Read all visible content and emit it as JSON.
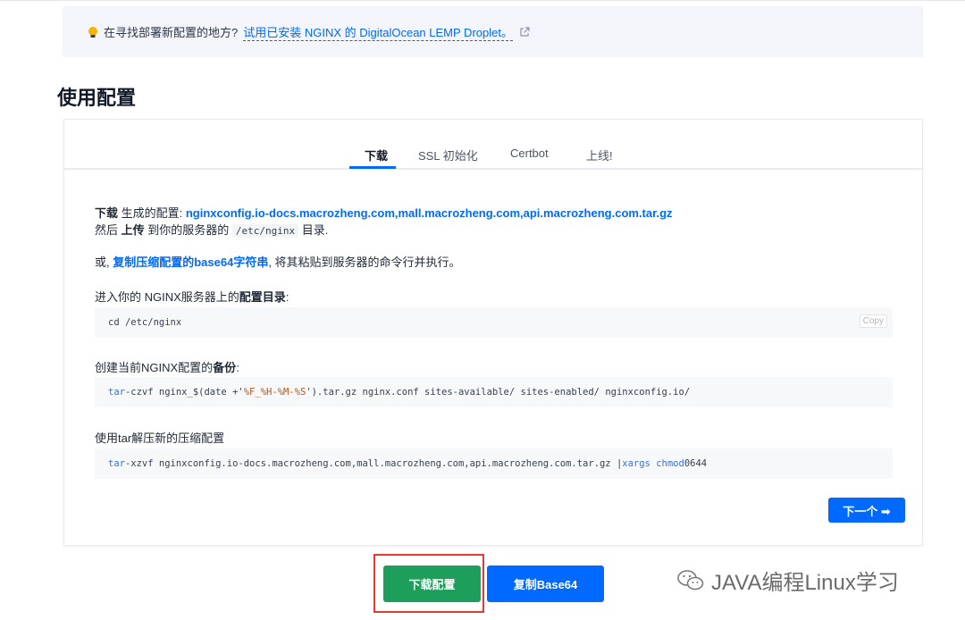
{
  "notice": {
    "question": "在寻找部署新配置的地方?",
    "link": "试用已安装 NGINX 的 DigitalOcean LEMP Droplet。",
    "icons": [
      "lightbulb-icon",
      "external-link-icon"
    ]
  },
  "section_title": "使用配置",
  "tabs": [
    {
      "label": "下载",
      "active": true
    },
    {
      "label": "SSL 初始化",
      "active": false
    },
    {
      "label": "Certbot",
      "active": false
    },
    {
      "label": "上线!",
      "active": false
    }
  ],
  "download": {
    "prefix_bold": "下载",
    "prefix": " 生成的配置: ",
    "file_link": "nginxconfig.io-docs.macrozheng.com,mall.macrozheng.com,api.macrozheng.com.tar.gz",
    "line2_a": "然后 ",
    "line2_bold": "上传",
    "line2_b": " 到你的服务器的 ",
    "line2_code": "/etc/nginx",
    "line2_c": " 目录."
  },
  "alt": {
    "prefix": "或, ",
    "link": "复制压缩配置的base64字符串",
    "suffix": ", 将其粘贴到服务器的命令行并执行。"
  },
  "step1": {
    "label_a": "进入你的 NGINX服务器上的",
    "label_bold": "配置目录",
    "label_b": ":",
    "code": "cd /etc/nginx",
    "copy": "Copy"
  },
  "step2": {
    "label_a": "创建当前NGINX配置的",
    "label_bold": "备份",
    "label_b": ":",
    "code_kw": "tar",
    "code_a": " -czvf nginx_$(date +'",
    "code_str": "%F_%H-%M-%S",
    "code_b": "').tar.gz nginx.conf sites-available/ sites-enabled/ nginxconfig.io/"
  },
  "step3": {
    "label": "使用tar解压新的压缩配置",
    "code_kw": "tar",
    "code_a": " -xzvf nginxconfig.io-docs.macrozheng.com,mall.macrozheng.com,api.macrozheng.com.tar.gz | ",
    "code_kw2": "xargs chmod",
    "code_b": " 0644"
  },
  "next_button": "下一个 ➡",
  "buttons": {
    "download": "下载配置",
    "copy_base64": "复制Base64"
  },
  "watermark": "JAVA编程Linux学习",
  "colors": {
    "accent": "#0069ff",
    "download_green": "#1d9e5a",
    "highlight_red": "#e53935"
  }
}
